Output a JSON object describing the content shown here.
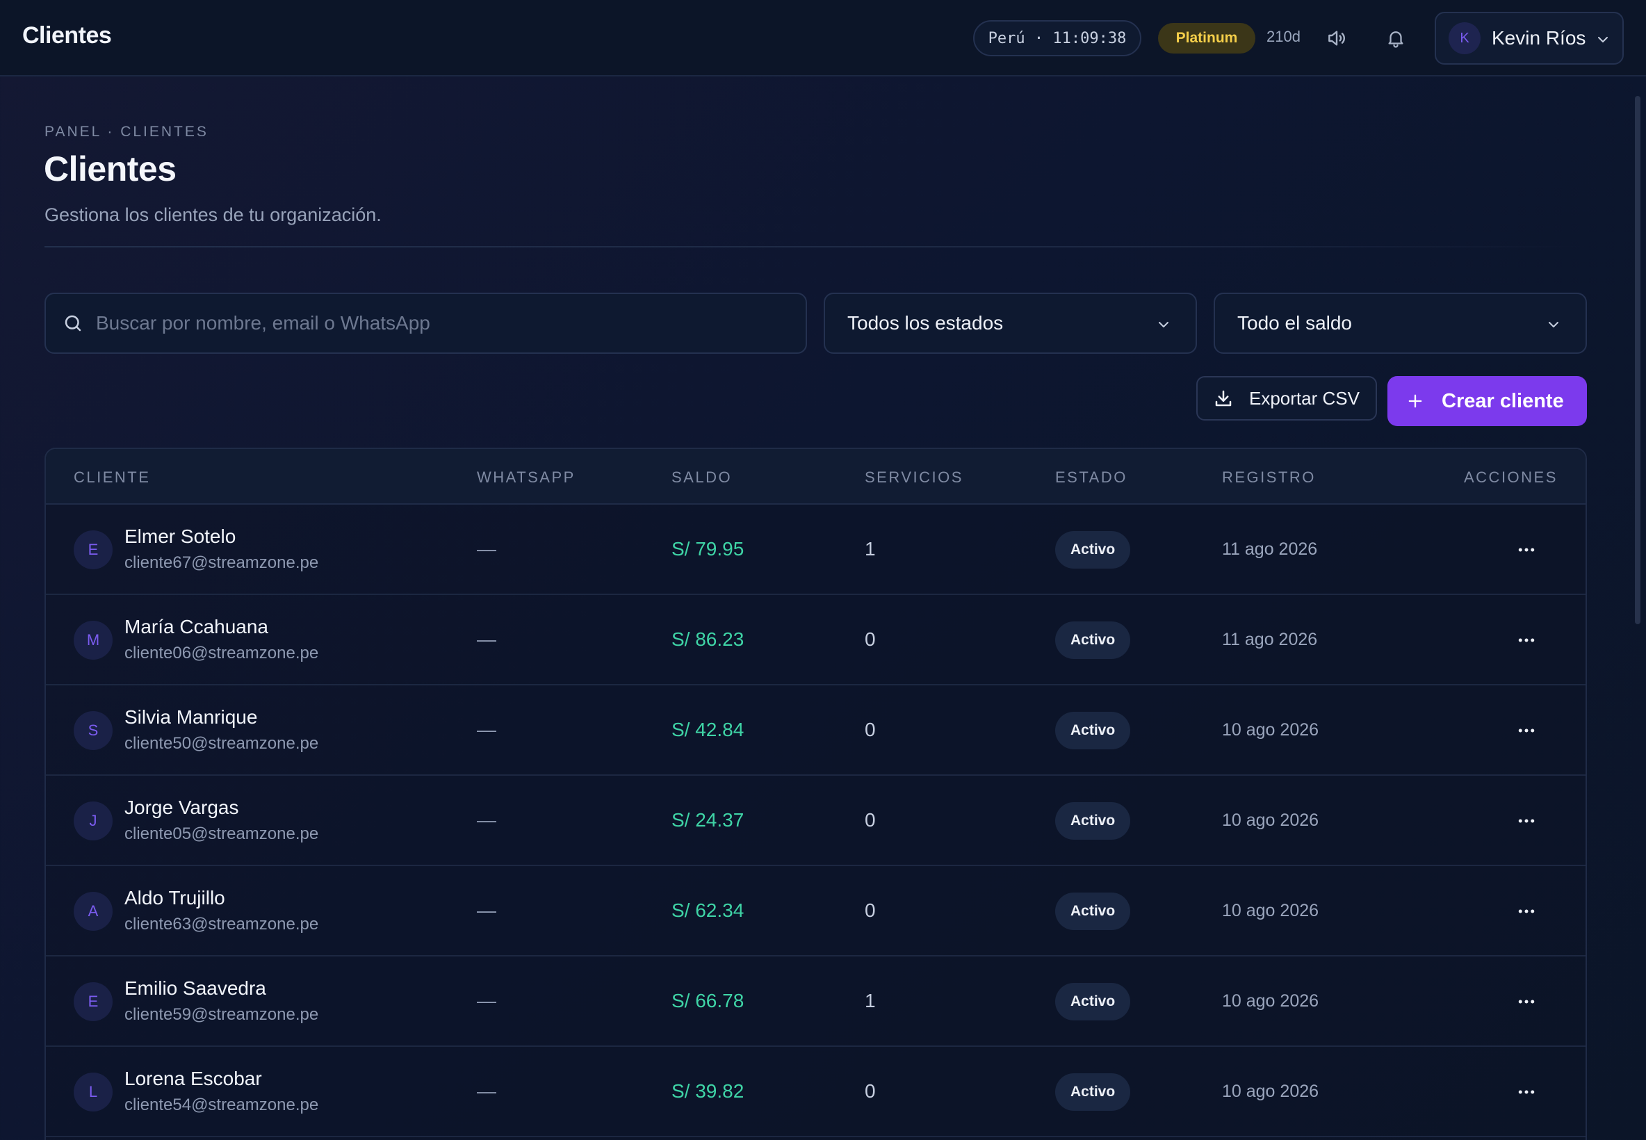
{
  "topbar": {
    "title": "Clientes",
    "clock": "Perú · 11:09:38",
    "tier": "Platinum",
    "days": "210d",
    "user_initial": "K",
    "user_name": "Kevin Ríos"
  },
  "header": {
    "breadcrumb": "PANEL · CLIENTES",
    "title": "Clientes",
    "subtitle": "Gestiona los clientes de tu organización."
  },
  "filters": {
    "search_placeholder": "Buscar por nombre, email o WhatsApp",
    "status_selected": "Todos los estados",
    "balance_selected": "Todo el saldo"
  },
  "actions": {
    "export_label": "Exportar CSV",
    "create_label": "Crear cliente"
  },
  "colors": {
    "accent": "#7c3aed",
    "money": "#3fd4a6",
    "tier": "#f5cf4a"
  },
  "table": {
    "columns": [
      "CLIENTE",
      "WHATSAPP",
      "SALDO",
      "SERVICIOS",
      "ESTADO",
      "REGISTRO",
      "ACCIONES"
    ],
    "rows": [
      {
        "initial": "E",
        "name": "Elmer Sotelo",
        "email": "cliente67@streamzone.pe",
        "whatsapp": "—",
        "saldo": "S/ 79.95",
        "servicios": "1",
        "estado": "Activo",
        "registro": "11 ago 2026"
      },
      {
        "initial": "M",
        "name": "María Ccahuana",
        "email": "cliente06@streamzone.pe",
        "whatsapp": "—",
        "saldo": "S/ 86.23",
        "servicios": "0",
        "estado": "Activo",
        "registro": "11 ago 2026"
      },
      {
        "initial": "S",
        "name": "Silvia Manrique",
        "email": "cliente50@streamzone.pe",
        "whatsapp": "—",
        "saldo": "S/ 42.84",
        "servicios": "0",
        "estado": "Activo",
        "registro": "10 ago 2026"
      },
      {
        "initial": "J",
        "name": "Jorge Vargas",
        "email": "cliente05@streamzone.pe",
        "whatsapp": "—",
        "saldo": "S/ 24.37",
        "servicios": "0",
        "estado": "Activo",
        "registro": "10 ago 2026"
      },
      {
        "initial": "A",
        "name": "Aldo Trujillo",
        "email": "cliente63@streamzone.pe",
        "whatsapp": "—",
        "saldo": "S/ 62.34",
        "servicios": "0",
        "estado": "Activo",
        "registro": "10 ago 2026"
      },
      {
        "initial": "E",
        "name": "Emilio Saavedra",
        "email": "cliente59@streamzone.pe",
        "whatsapp": "—",
        "saldo": "S/ 66.78",
        "servicios": "1",
        "estado": "Activo",
        "registro": "10 ago 2026"
      },
      {
        "initial": "L",
        "name": "Lorena Escobar",
        "email": "cliente54@streamzone.pe",
        "whatsapp": "—",
        "saldo": "S/ 39.82",
        "servicios": "0",
        "estado": "Activo",
        "registro": "10 ago 2026"
      }
    ]
  }
}
